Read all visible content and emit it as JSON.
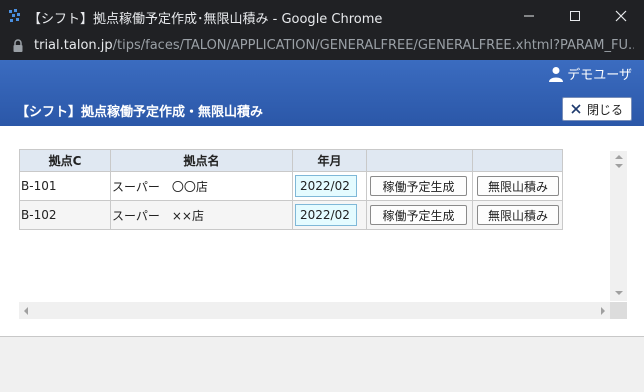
{
  "window": {
    "title": "【シフト】拠点稼働予定作成･無限山積み - Google Chrome",
    "url_host": "trial.talon.jp",
    "url_path": "/tips/faces/TALON/APPLICATION/GENERALFREE/GENERALFREE.xhtml?PARAM_FU..."
  },
  "header": {
    "user_name": "デモユーザ",
    "page_title": "【シフト】拠点稼働予定作成・無限山積み",
    "close_label": "閉じる"
  },
  "table": {
    "columns": [
      "拠点C",
      "拠点名",
      "年月",
      "",
      ""
    ],
    "rows": [
      {
        "code": "B-101",
        "name": "スーパー　〇〇店",
        "ym": "2022/02",
        "gen_label": "稼働予定生成",
        "yama_label": "無限山積み"
      },
      {
        "code": "B-102",
        "name": "スーパー　××店",
        "ym": "2022/02",
        "gen_label": "稼働予定生成",
        "yama_label": "無限山積み"
      }
    ]
  },
  "colors": {
    "header_blue": "#2b57a8",
    "table_header_bg": "#e0e8f2",
    "date_field_bg": "#e4fbff"
  },
  "icons": [
    "app-icon",
    "minimize-icon",
    "maximize-icon",
    "close-window-icon",
    "lock-icon",
    "user-icon",
    "close-x-icon",
    "scroll-arrow-icons"
  ]
}
